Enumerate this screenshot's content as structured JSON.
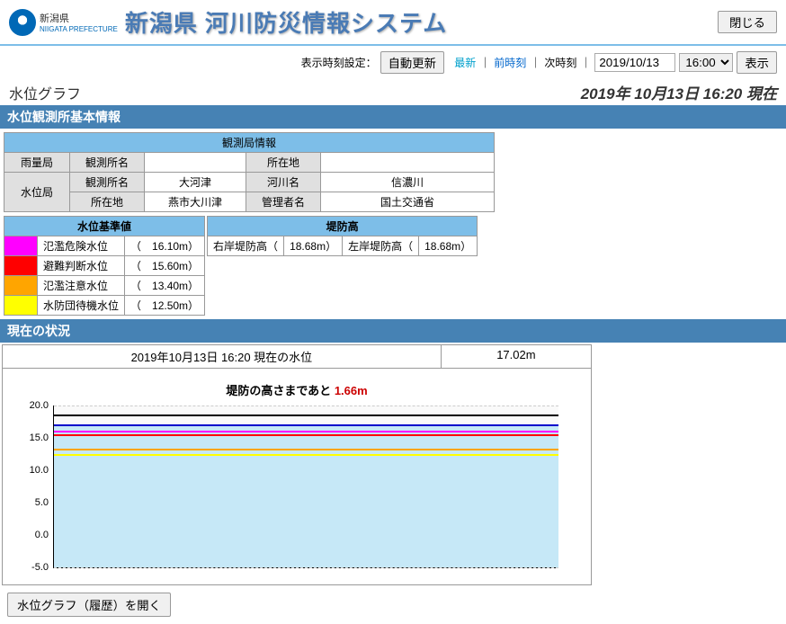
{
  "header": {
    "prefecture_small": "新潟県",
    "prefecture_en": "NIIGATA PREFECTURE",
    "title": "新潟県 河川防災情報システム",
    "close": "閉じる"
  },
  "controls": {
    "label": "表示時刻設定：",
    "auto_update": "自動更新",
    "latest": "最新",
    "prev": "前時刻",
    "next": "次時刻",
    "date": "2019/10/13",
    "time": "16:00",
    "show": "表示"
  },
  "page": {
    "title": "水位グラフ",
    "timestamp": "2019年 10月13日 16:20 現在"
  },
  "sections": {
    "basic_info": "水位観測所基本情報",
    "current": "現在の状況"
  },
  "station_info": {
    "header": "観測局情報",
    "rain_label": "雨量局",
    "station_name_label": "観測所名",
    "location_label": "所在地",
    "water_label": "水位局",
    "station_name": "大河津",
    "river_label": "河川名",
    "river": "信濃川",
    "location": "燕市大川津",
    "admin_label": "管理者名",
    "admin": "国土交通省"
  },
  "standards": {
    "header": "水位基準値",
    "items": [
      {
        "color": "c-magenta",
        "label": "氾濫危険水位",
        "value": "（　16.10m）"
      },
      {
        "color": "c-red",
        "label": "避難判断水位",
        "value": "（　15.60m）"
      },
      {
        "color": "c-orange",
        "label": "氾濫注意水位",
        "value": "（　13.40m）"
      },
      {
        "color": "c-yellow",
        "label": "水防団待機水位",
        "value": "（　12.50m）"
      }
    ]
  },
  "levee": {
    "header": "堤防高",
    "right_label": "右岸堤防高（",
    "right_val": "18.68m）",
    "left_label": "左岸堤防高（",
    "left_val": "18.68m）"
  },
  "status": {
    "row_label": "2019年10月13日 16:20 現在の水位",
    "row_value": "17.02m",
    "chart_title_pre": "堤防の高さまであと",
    "chart_title_diff": "1.66m"
  },
  "chart_data": {
    "type": "line",
    "title": "堤防の高さまであと 1.66m",
    "xlabel": "",
    "ylabel": "",
    "ylim": [
      -5,
      20
    ],
    "y_ticks": [
      -5,
      0,
      5,
      10,
      15,
      20
    ],
    "current_level": 17.02,
    "levee_height": 18.68,
    "thresholds": [
      {
        "name": "氾濫危険水位",
        "value": 16.1,
        "color": "#FF00FF"
      },
      {
        "name": "避難判断水位",
        "value": 15.6,
        "color": "#FF0000"
      },
      {
        "name": "氾濫注意水位",
        "value": 13.4,
        "color": "#FFA500"
      },
      {
        "name": "水防団待機水位",
        "value": 12.5,
        "color": "#FFFF00"
      }
    ]
  },
  "history_button": "水位グラフ（履歴）を開く"
}
